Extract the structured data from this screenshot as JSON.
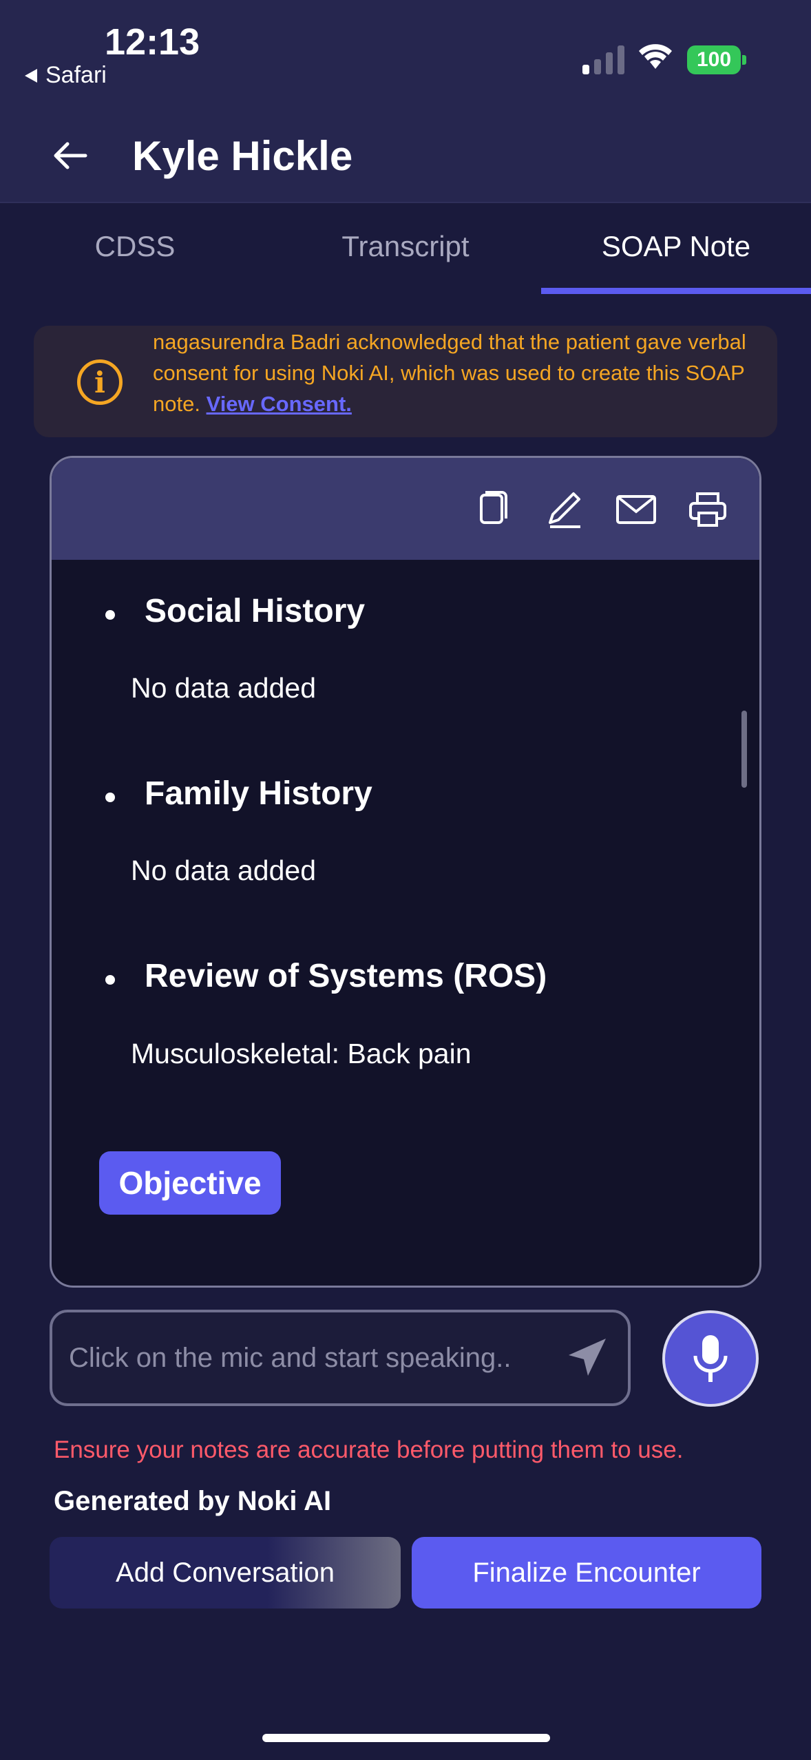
{
  "status_bar": {
    "time": "12:13",
    "back_app": "Safari",
    "battery": "100"
  },
  "header": {
    "title": "Kyle Hickle"
  },
  "tabs": [
    {
      "label": "CDSS"
    },
    {
      "label": "Transcript"
    },
    {
      "label": "SOAP Note",
      "active": true
    }
  ],
  "consent_banner": {
    "text": "nagasurendra Badri acknowledged that the patient gave verbal consent for using Noki AI, which was used to create this SOAP note.",
    "link": "View Consent."
  },
  "toolbar_icons": [
    "copy-icon",
    "edit-icon",
    "mail-icon",
    "print-icon"
  ],
  "note_sections": [
    {
      "title": "Social History",
      "body": "No data added"
    },
    {
      "title": "Family History",
      "body": "No data added"
    },
    {
      "title": "Review of Systems (ROS)",
      "body": "Musculoskeletal: Back pain"
    }
  ],
  "section_badge": "Objective",
  "input": {
    "placeholder": "Click on the mic and start speaking.."
  },
  "warning": "Ensure your notes are accurate before putting them to use.",
  "generated_by": "Generated by Noki AI",
  "buttons": {
    "add_conversation": "Add Conversation",
    "finalize": "Finalize Encounter"
  },
  "colors": {
    "accent": "#5b5bf0",
    "warning": "#f5a623",
    "error": "#ff5a6a",
    "background": "#1a1a3c"
  }
}
